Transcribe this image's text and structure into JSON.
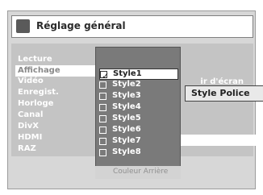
{
  "title": "Réglage général",
  "menu": [
    "Lecture",
    "Affichage",
    "Vidéo",
    "Enregist.",
    "Horloge",
    "Canal",
    "DivX",
    "HDMI",
    "RAZ"
  ],
  "selected_menu_index": 1,
  "right_hint": "ir d'écran",
  "popup": {
    "title": "Style Police",
    "options": [
      "Style1",
      "Style2",
      "Style3",
      "Style4",
      "Style5",
      "Style6",
      "Style7",
      "Style8"
    ],
    "checked_index": 0
  },
  "footer": "Couleur Arrière",
  "colors": {
    "panel": "#d7d7d7",
    "popup_bg": "#7a7a7a",
    "selected": "#ffffff"
  }
}
